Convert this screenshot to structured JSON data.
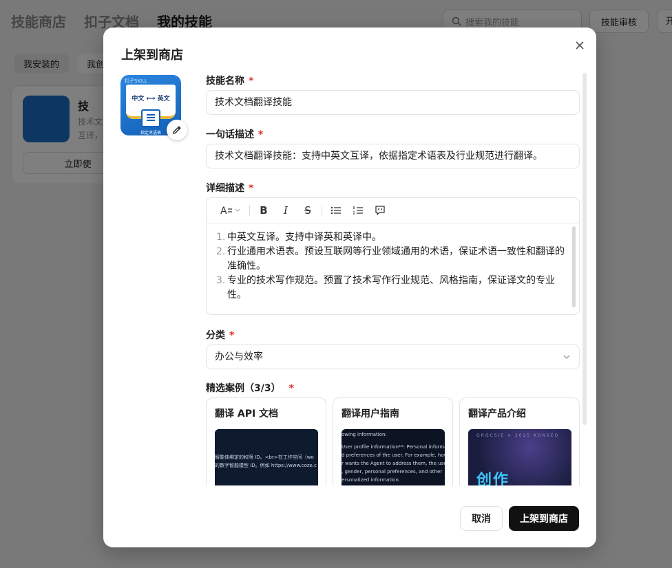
{
  "background": {
    "tabs": [
      "技能商店",
      "扣子文档",
      "我的技能"
    ],
    "search_placeholder": "搜索我的技能",
    "review_button": "技能审核",
    "extra_button": "开",
    "filters": [
      "我安装的",
      "我创"
    ],
    "card": {
      "title": "技",
      "desc_line1": "技术文",
      "desc_line2": "互译，",
      "button": "立即使"
    }
  },
  "modal": {
    "title": "上架到商店",
    "close_icon": "close-icon",
    "skill_icon": {
      "badge": "扣子SKILL",
      "book_text": "中文 ⟷ 英文",
      "doc_label": "指定术语表"
    },
    "fields": {
      "name": {
        "label": "技能名称",
        "required": "*",
        "value": "技术文档翻译技能"
      },
      "summary": {
        "label": "一句话描述",
        "required": "*",
        "value": "技术文档翻译技能：支持中英文互译，依据指定术语表及行业规范进行翻译。"
      },
      "detail": {
        "label": "详细描述",
        "required": "*",
        "items": [
          "中英文互译。支持中译英和英译中。",
          "行业通用术语表。预设互联网等行业领域通用的术语，保证术语一致性和翻译的准确性。",
          "专业的技术写作规范。预置了技术写作行业规范、风格指南，保证译文的专业性。"
        ]
      },
      "category": {
        "label": "分类",
        "required": "*",
        "value": "办公与效率"
      },
      "cases": {
        "label": "精选案例（3/3）",
        "required": "*",
        "items": [
          {
            "title": "翻译 API 文档",
            "snippet1": "智能体绑定的权限 ID。<br>在工作空间（wo",
            "snippet2": "的数字智能模型 ID。例如 https://www.coze.c"
          },
          {
            "title": "翻译用户指南",
            "snippet1": "owing information:",
            "snippet2": "User profile information**: Personal informatio",
            "snippet3": "d preferences of the user. For example, how th",
            "snippet4": "r wants the Agent to address them, the user's",
            "snippet5": ", gender, personal preferences, and other",
            "snippet6": "ersonalized information."
          },
          {
            "title": "翻译产品介绍",
            "tiny": "GROCSIE × 2025 KONSEO",
            "big": "创作"
          }
        ]
      }
    },
    "buttons": {
      "cancel": "取消",
      "publish": "上架到商店"
    }
  }
}
